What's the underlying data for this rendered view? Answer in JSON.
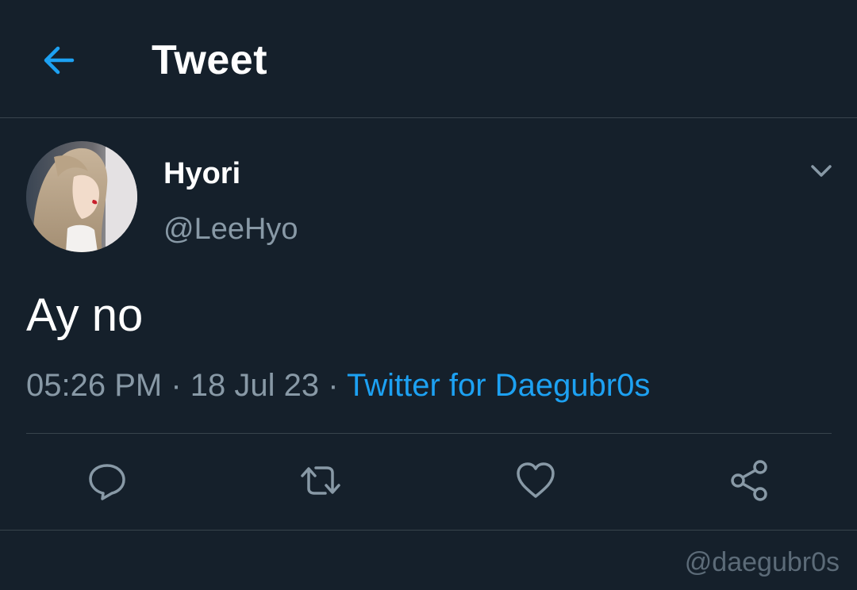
{
  "header": {
    "title": "Tweet",
    "back_icon": "arrow-left-icon"
  },
  "tweet": {
    "author": {
      "display_name": "Hyori",
      "handle": "@LeeHyo"
    },
    "text": "Ay no",
    "time": "05:26 PM",
    "date": "18 Jul 23",
    "separator": "·",
    "source": "Twitter for Daegubr0s"
  },
  "actions": [
    {
      "name": "reply",
      "icon": "reply-icon"
    },
    {
      "name": "retweet",
      "icon": "retweet-icon"
    },
    {
      "name": "like",
      "icon": "heart-icon"
    },
    {
      "name": "share",
      "icon": "share-icon"
    }
  ],
  "watermark": "@daegubr0s",
  "colors": {
    "background": "#15202b",
    "accent": "#1da1f2",
    "secondary_text": "#8899a6",
    "divider": "#38444d"
  }
}
